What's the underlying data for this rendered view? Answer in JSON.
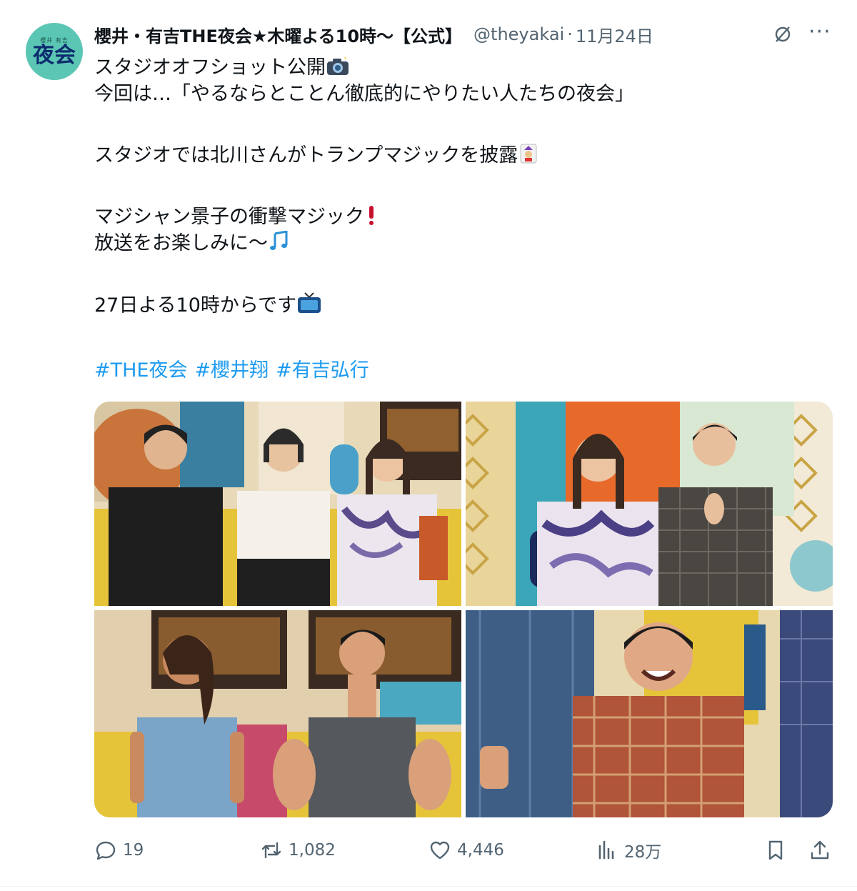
{
  "account": {
    "display_name": "櫻井・有吉THE夜会★木曜よる10時～【公式】",
    "handle": "@theyakai",
    "separator": "·",
    "date": "11月24日",
    "avatar_small_text": "櫻井 有吉",
    "avatar_big_text": "夜会"
  },
  "post": {
    "lines": [
      "スタジオオフショット公開",
      "今回は…「やるならとことん徹底的にやりたい人たちの夜会」",
      "スタジオでは北川さんがトランプマジックを披露",
      "マジシャン景子の衝撃マジック",
      "放送をお楽しみに～",
      "27日よる10時からです"
    ],
    "emojis": {
      "line1": "camera-flash",
      "line3": "joker-card",
      "line4": "exclamation",
      "line5": "music-notes",
      "line6": "television"
    },
    "hashtags": [
      "#THE夜会",
      "#櫻井翔",
      "#有吉弘行"
    ]
  },
  "media": {
    "photos": [
      {
        "desc": "studio-offshot-1"
      },
      {
        "desc": "studio-offshot-2"
      },
      {
        "desc": "studio-offshot-3"
      },
      {
        "desc": "studio-offshot-4"
      }
    ]
  },
  "metrics": {
    "replies": "19",
    "reposts": "1,082",
    "likes": "4,446",
    "views": "28万"
  },
  "colors": {
    "link": "#1d9bf0",
    "secondary_text": "#536471",
    "avatar_bg": "#5cc6b4"
  }
}
